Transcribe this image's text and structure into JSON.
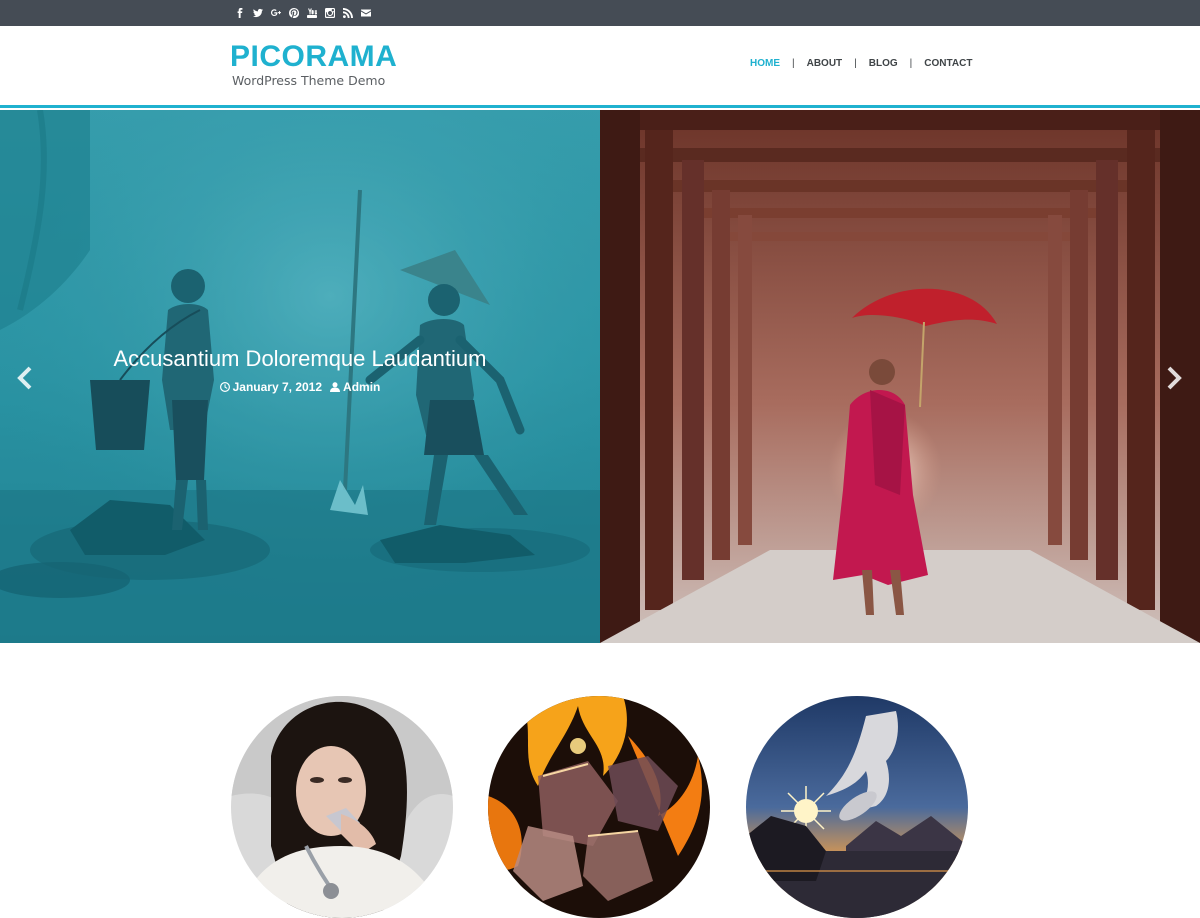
{
  "colors": {
    "accent": "#1fb1cf",
    "topbar": "#454c55",
    "nav_text": "#3f4447",
    "white": "#ffffff"
  },
  "social_icons": [
    "facebook-icon",
    "twitter-icon",
    "google-plus-icon",
    "pinterest-icon",
    "youtube-icon",
    "instagram-icon",
    "rss-icon",
    "email-icon"
  ],
  "site": {
    "title": "PICORAMA",
    "tagline": "WordPress Theme Demo"
  },
  "nav": {
    "items": [
      {
        "label": "HOME",
        "active": true
      },
      {
        "label": "ABOUT",
        "active": false
      },
      {
        "label": "BLOG",
        "active": false
      },
      {
        "label": "CONTACT",
        "active": false
      }
    ],
    "separator": "|"
  },
  "slider": {
    "active_caption": {
      "title": "Accusantium Doloremque Laudantium",
      "date": "January 7, 2012",
      "author": "Admin"
    },
    "left_image": "two boys fishing in misty water (teal overlay)",
    "right_image": "young monk with red umbrella in wooden corridor"
  },
  "featured": [
    "woman with jewelry",
    "ice cubes and fire",
    "bird over sunset sea"
  ]
}
